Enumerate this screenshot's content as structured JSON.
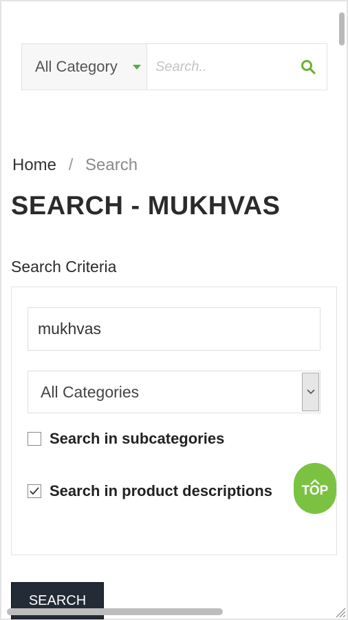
{
  "header": {
    "category_select": "All Category",
    "search_placeholder": "Search.."
  },
  "breadcrumb": {
    "home": "Home",
    "separator": "/",
    "current": "Search"
  },
  "page_title": "SEARCH - MUKHVAS",
  "criteria": {
    "label": "Search Criteria",
    "keyword_value": "mukhvas",
    "category_value": "All Categories",
    "subcategories_label": "Search in subcategories",
    "subcategories_checked": false,
    "descriptions_label": "Search in product descriptions",
    "descriptions_checked": true
  },
  "top_button": {
    "label": "TOP"
  },
  "submit_button": {
    "label": "SEARCH"
  },
  "colors": {
    "accent_green": "#7cc242",
    "button_dark": "#232b36"
  },
  "icons": [
    "search-icon",
    "caret-down-icon",
    "chevron-down-icon",
    "checkmark-icon",
    "chevron-up-icon"
  ]
}
